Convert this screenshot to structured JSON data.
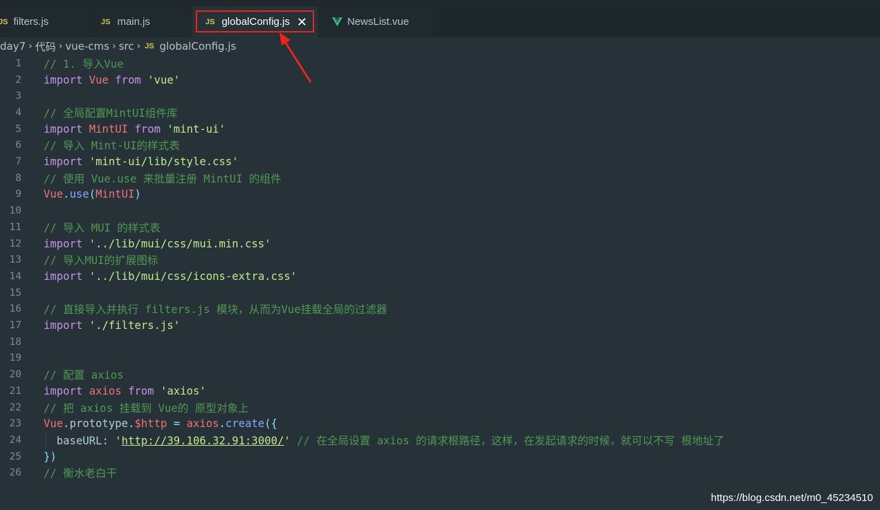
{
  "tabs": [
    {
      "label": "filters.js",
      "type": "js",
      "active": false
    },
    {
      "label": "main.js",
      "type": "js",
      "active": false
    },
    {
      "label": "globalConfig.js",
      "type": "js",
      "active": true,
      "close": "✕"
    },
    {
      "label": "NewsList.vue",
      "type": "vue",
      "active": false
    }
  ],
  "icons": {
    "js": "JS",
    "vue": "vue-icon"
  },
  "breadcrumb": {
    "items": [
      "day7",
      "代码",
      "vue-cms",
      "src"
    ],
    "file": "globalConfig.js",
    "separator": "›"
  },
  "code": {
    "lines": [
      {
        "n": "1",
        "tokens": [
          [
            "comment",
            "// 1. 导入Vue"
          ]
        ]
      },
      {
        "n": "2",
        "tokens": [
          [
            "kw",
            "import"
          ],
          [
            "plain",
            " "
          ],
          [
            "var",
            "Vue"
          ],
          [
            "plain",
            " "
          ],
          [
            "kw",
            "from"
          ],
          [
            "plain",
            " "
          ],
          [
            "str",
            "'vue'"
          ]
        ]
      },
      {
        "n": "3",
        "tokens": []
      },
      {
        "n": "4",
        "tokens": [
          [
            "comment",
            "// 全局配置MintUI组件库"
          ]
        ]
      },
      {
        "n": "5",
        "tokens": [
          [
            "kw",
            "import"
          ],
          [
            "plain",
            " "
          ],
          [
            "var",
            "MintUI"
          ],
          [
            "plain",
            " "
          ],
          [
            "kw",
            "from"
          ],
          [
            "plain",
            " "
          ],
          [
            "str",
            "'mint-ui'"
          ]
        ]
      },
      {
        "n": "6",
        "tokens": [
          [
            "comment",
            "// 导入 Mint-UI的样式表"
          ]
        ]
      },
      {
        "n": "7",
        "tokens": [
          [
            "kw",
            "import"
          ],
          [
            "plain",
            " "
          ],
          [
            "str",
            "'mint-ui/lib/style.css'"
          ]
        ]
      },
      {
        "n": "8",
        "tokens": [
          [
            "comment",
            "// 使用 Vue.use 来批量注册 MintUI 的组件"
          ]
        ]
      },
      {
        "n": "9",
        "tokens": [
          [
            "var",
            "Vue"
          ],
          [
            "punc",
            "."
          ],
          [
            "fn",
            "use"
          ],
          [
            "punc",
            "("
          ],
          [
            "var",
            "MintUI"
          ],
          [
            "punc",
            ")"
          ]
        ]
      },
      {
        "n": "10",
        "tokens": []
      },
      {
        "n": "11",
        "tokens": [
          [
            "comment",
            "// 导入 MUI 的样式表"
          ]
        ]
      },
      {
        "n": "12",
        "tokens": [
          [
            "kw",
            "import"
          ],
          [
            "plain",
            " "
          ],
          [
            "str",
            "'../lib/mui/css/mui.min.css'"
          ]
        ]
      },
      {
        "n": "13",
        "tokens": [
          [
            "comment",
            "// 导入MUI的扩展图标"
          ]
        ]
      },
      {
        "n": "14",
        "tokens": [
          [
            "kw",
            "import"
          ],
          [
            "plain",
            " "
          ],
          [
            "str",
            "'../lib/mui/css/icons-extra.css'"
          ]
        ]
      },
      {
        "n": "15",
        "tokens": []
      },
      {
        "n": "16",
        "tokens": [
          [
            "comment",
            "// 直接导入并执行 filters.js 模块，从而为Vue挂载全局的过滤器"
          ]
        ]
      },
      {
        "n": "17",
        "tokens": [
          [
            "kw",
            "import"
          ],
          [
            "plain",
            " "
          ],
          [
            "str",
            "'./filters.js'"
          ]
        ]
      },
      {
        "n": "18",
        "tokens": []
      },
      {
        "n": "19",
        "tokens": []
      },
      {
        "n": "20",
        "tokens": [
          [
            "comment",
            "// 配置 axios"
          ]
        ]
      },
      {
        "n": "21",
        "tokens": [
          [
            "kw",
            "import"
          ],
          [
            "plain",
            " "
          ],
          [
            "var",
            "axios"
          ],
          [
            "plain",
            " "
          ],
          [
            "kw",
            "from"
          ],
          [
            "plain",
            " "
          ],
          [
            "str",
            "'axios'"
          ]
        ]
      },
      {
        "n": "22",
        "tokens": [
          [
            "comment",
            "// 把 axios 挂载到 Vue的 原型对象上"
          ]
        ]
      },
      {
        "n": "23",
        "tokens": [
          [
            "var",
            "Vue"
          ],
          [
            "punc",
            "."
          ],
          [
            "prop",
            "prototype"
          ],
          [
            "punc",
            "."
          ],
          [
            "var",
            "$http"
          ],
          [
            "plain",
            " "
          ],
          [
            "punc",
            "="
          ],
          [
            "plain",
            " "
          ],
          [
            "var",
            "axios"
          ],
          [
            "punc",
            "."
          ],
          [
            "fn",
            "create"
          ],
          [
            "punc",
            "({"
          ]
        ]
      },
      {
        "n": "24",
        "tokens": [
          [
            "plain",
            "  "
          ],
          [
            "prop",
            "baseURL"
          ],
          [
            "punc",
            ":"
          ],
          [
            "plain",
            " "
          ],
          [
            "strq",
            "'"
          ],
          [
            "url",
            "http://39.106.32.91:3000/"
          ],
          [
            "strq",
            "'"
          ],
          [
            "plain",
            " "
          ],
          [
            "comment",
            "// 在全局设置 axios 的请求根路径，这样，在发起请求的时候，就可以不写 根地址了"
          ]
        ]
      },
      {
        "n": "25",
        "tokens": [
          [
            "punc",
            "})"
          ]
        ]
      },
      {
        "n": "26",
        "tokens": [
          [
            "comment",
            "// 衡水老白干"
          ]
        ]
      }
    ]
  },
  "watermark": "https://blog.csdn.net/m0_45234510",
  "colors": {
    "editor_bg": "#263238",
    "highlight": "#e8261d",
    "comment": "#4e9a52",
    "keyword": "#c792ea",
    "variable": "#f07178",
    "string": "#c3e88d"
  }
}
